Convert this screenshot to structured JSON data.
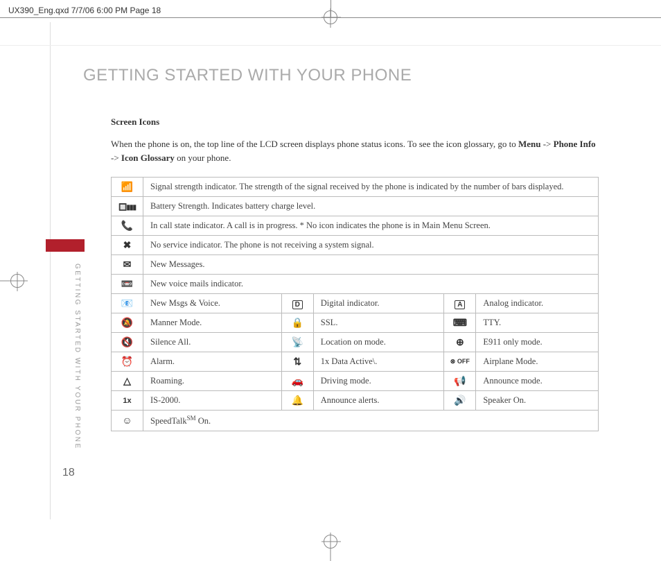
{
  "crop_info": "UX390_Eng.qxd  7/7/06  6:00 PM  Page 18",
  "heading": "GETTING STARTED WITH YOUR PHONE",
  "sidetext": "GETTING STARTED WITH YOUR PHONE",
  "page_number": "18",
  "section_title": "Screen Icons",
  "intro_pre": "When the phone is on, the top line of the LCD screen displays phone status icons. To see the icon glossary, go to ",
  "intro_b1": "Menu",
  "intro_arrow": " -> ",
  "intro_b2": "Phone Info",
  "intro_b3": "Icon Glossary",
  "intro_post": " on your phone.",
  "rows_full": [
    {
      "icon": "📶",
      "desc": "Signal strength indicator. The strength of the signal received by the phone is indicated by the number of bars displayed."
    },
    {
      "icon": "🔲▮▮▮",
      "desc": "Battery Strength. Indicates battery charge level."
    },
    {
      "icon": "📞",
      "desc": "In call state indicator. A call is in progress. * No icon indicates the phone is in Main Menu Screen."
    },
    {
      "icon": "✖",
      "desc": "No service indicator. The phone is not receiving a system signal."
    },
    {
      "icon": "✉",
      "desc": "New Messages."
    },
    {
      "icon": "📼",
      "desc": "New voice mails indicator."
    }
  ],
  "rows_triple": [
    {
      "c1i": "📧",
      "c1": "New Msgs & Voice.",
      "c2i": "D",
      "c2": "Digital indicator.",
      "c3i": "A",
      "c3": "Analog indicator."
    },
    {
      "c1i": "🔕",
      "c1": "Manner Mode.",
      "c2i": "🔒",
      "c2": "SSL.",
      "c3i": "⌨",
      "c3": "TTY."
    },
    {
      "c1i": "🔇",
      "c1": "Silence All.",
      "c2i": "📡",
      "c2": "Location on mode.",
      "c3i": "⊕",
      "c3": "E911 only mode."
    },
    {
      "c1i": "⏰",
      "c1": "Alarm.",
      "c2i": "⇅",
      "c2": "1x Data Active\\.",
      "c3i": "⊗ OFF",
      "c3": "Airplane Mode."
    },
    {
      "c1i": "△",
      "c1": "Roaming.",
      "c2i": "🚗",
      "c2": "Driving mode.",
      "c3i": "📢",
      "c3": "Announce mode."
    },
    {
      "c1i": "1x",
      "c1": "IS-2000.",
      "c2i": "🔔",
      "c2": "Announce alerts.",
      "c3i": "🔊",
      "c3": "Speaker On."
    }
  ],
  "row_last": {
    "icon": "☺",
    "desc_pre": "SpeedTalk",
    "desc_sm": "SM",
    "desc_post": " On."
  }
}
